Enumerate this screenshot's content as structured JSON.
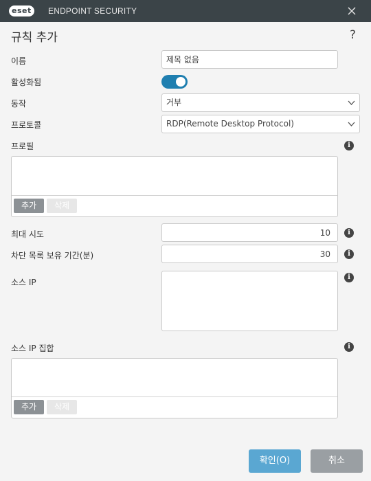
{
  "titlebar": {
    "logo_text": "eset",
    "product_name": "ENDPOINT SECURITY",
    "close_icon": "close-icon"
  },
  "dialog": {
    "title": "규칙 추가",
    "help_label": "?"
  },
  "form": {
    "name": {
      "label": "이름",
      "value": "제목 없음"
    },
    "enabled": {
      "label": "활성화됨",
      "state": true,
      "color": "#1f7fb0"
    },
    "action": {
      "label": "동작",
      "selected": "거부"
    },
    "protocol": {
      "label": "프로토콜",
      "selected": "RDP(Remote Desktop Protocol)"
    },
    "profile": {
      "label": "프로필",
      "add_label": "추가",
      "delete_label": "삭제"
    },
    "max_attempts": {
      "label": "최대 시도",
      "value": "10"
    },
    "blocklist_retention": {
      "label": "차단 목록 보유 기간(분)",
      "value": "30"
    },
    "source_ip": {
      "label": "소스 IP"
    },
    "source_ip_set": {
      "label": "소스 IP 집합",
      "add_label": "추가",
      "delete_label": "삭제"
    }
  },
  "info_icon_glyph": "i",
  "footer": {
    "ok_label": "확인(O)",
    "cancel_label": "취소",
    "ok_color": "#5aa7d2",
    "cancel_color": "#9a9fa3"
  }
}
